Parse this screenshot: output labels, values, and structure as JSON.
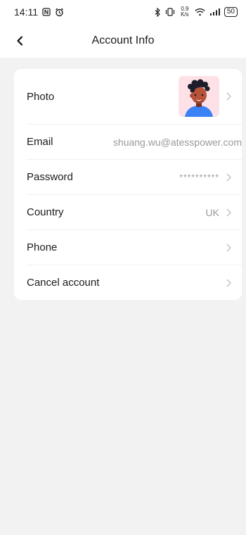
{
  "status_bar": {
    "time": "14:11",
    "net_speed": "0.9 K/s",
    "battery": "50"
  },
  "header": {
    "title": "Account Info"
  },
  "account": {
    "photo_label": "Photo",
    "email_label": "Email",
    "email_value": "shuang.wu@atesspower.com",
    "password_label": "Password",
    "password_value": "**********",
    "country_label": "Country",
    "country_value": "UK",
    "phone_label": "Phone",
    "cancel_label": "Cancel account"
  },
  "colors": {
    "background": "#f2f2f2",
    "card": "#ffffff",
    "value_text": "#9a9a9a",
    "avatar_bg": "#fde1e6",
    "avatar_shirt": "#3b82f6"
  }
}
